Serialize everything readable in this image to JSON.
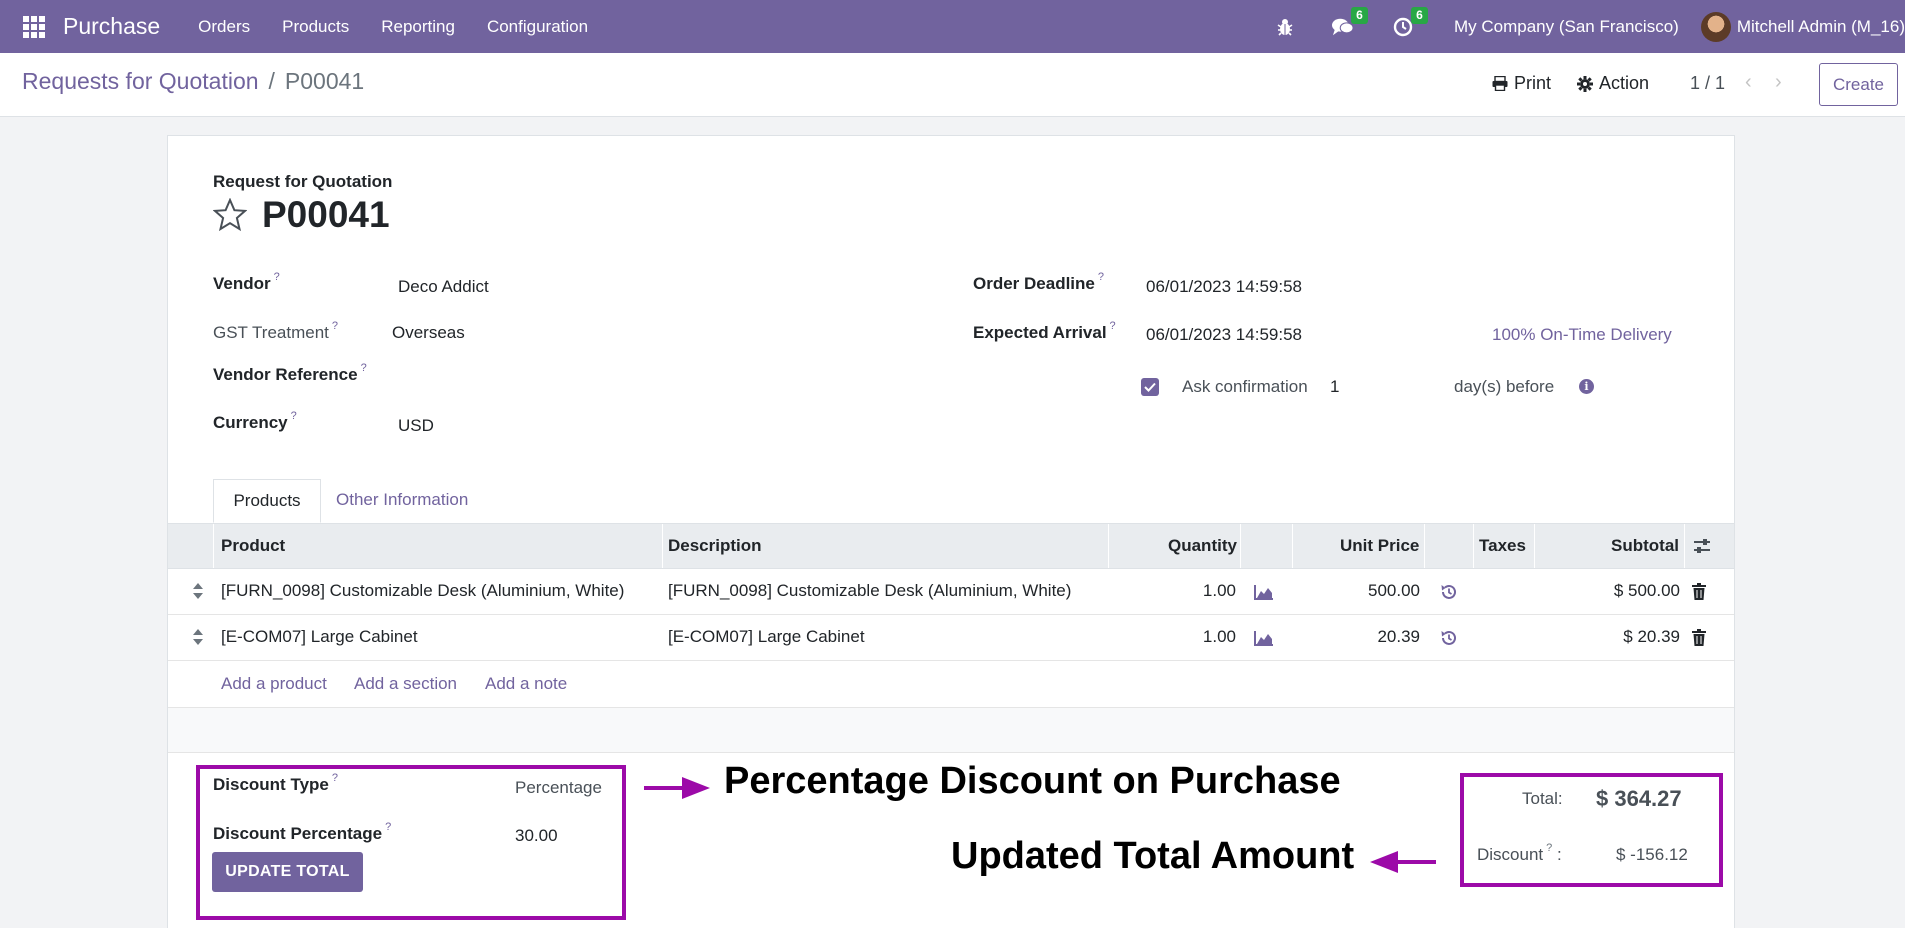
{
  "navbar": {
    "app_name": "Purchase",
    "menu": [
      "Orders",
      "Products",
      "Reporting",
      "Configuration"
    ],
    "messages_count": "6",
    "activities_count": "6",
    "company": "My Company (San Francisco)",
    "user": "Mitchell Admin (M_16)"
  },
  "control": {
    "breadcrumb_parent": "Requests for Quotation",
    "breadcrumb_separator": "/",
    "breadcrumb_current": "P00041",
    "print_label": "Print",
    "action_label": "Action",
    "pager": "1 / 1",
    "create_label": "Create"
  },
  "form": {
    "doc_type": "Request for Quotation",
    "name": "P00041",
    "q_mark": "?",
    "vendor_label": "Vendor",
    "vendor_value": "Deco Addict",
    "gst_label": "GST Treatment",
    "gst_value": "Overseas",
    "vendor_ref_label": "Vendor Reference",
    "currency_label": "Currency",
    "currency_value": "USD",
    "deadline_label": "Order Deadline",
    "deadline_value": "06/01/2023 14:59:58",
    "arrival_label": "Expected Arrival",
    "arrival_value": "06/01/2023 14:59:58",
    "ontime_link": "100% On-Time Delivery",
    "ask_confirmation_label": "Ask confirmation",
    "ask_confirmation_days": "1",
    "days_before_label": "day(s) before"
  },
  "tabs": [
    {
      "label": "Products",
      "active": true
    },
    {
      "label": "Other Information",
      "active": false
    }
  ],
  "table": {
    "columns": [
      "Product",
      "Description",
      "Quantity",
      "Unit Price",
      "Taxes",
      "Subtotal"
    ],
    "rows": [
      {
        "product": "[FURN_0098] Customizable Desk (Aluminium, White)",
        "description": "[FURN_0098] Customizable Desk (Aluminium, White)",
        "quantity": "1.00",
        "unit_price": "500.00",
        "taxes": "",
        "subtotal": "$ 500.00"
      },
      {
        "product": "[E-COM07] Large Cabinet",
        "description": "[E-COM07] Large Cabinet",
        "quantity": "1.00",
        "unit_price": "20.39",
        "taxes": "",
        "subtotal": "$ 20.39"
      }
    ],
    "add_product": "Add a product",
    "add_section": "Add a section",
    "add_note": "Add a note"
  },
  "discount": {
    "type_label": "Discount Type",
    "type_value": "Percentage",
    "percentage_label": "Discount Percentage",
    "percentage_value": "30.00",
    "update_button": "UPDATE TOTAL"
  },
  "totals": {
    "total_label": "Total:",
    "total_value": "$ 364.27",
    "discount_label": "Discount",
    "discount_colon": ":",
    "discount_value": "$ -156.12"
  },
  "annotations": {
    "left": "Percentage Discount on Purchase",
    "right": "Updated Total Amount",
    "color": "#9c0aa8"
  }
}
